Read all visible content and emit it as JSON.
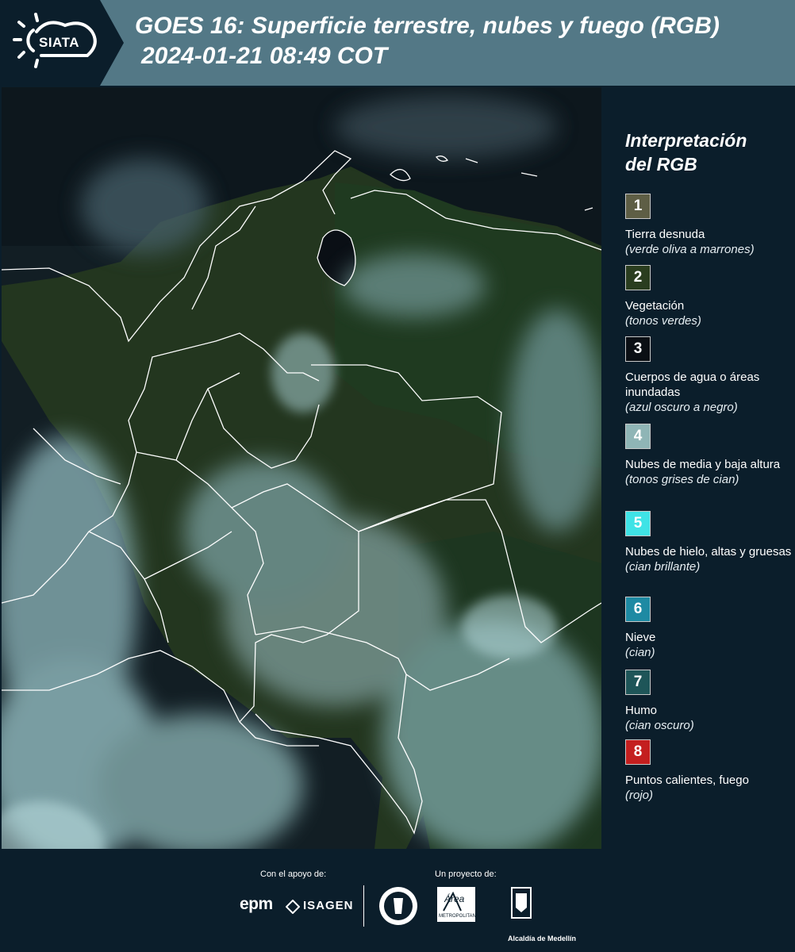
{
  "header": {
    "logo_text": "SIATA",
    "title": "GOES 16: Superficie terrestre, nubes y fuego (RGB)",
    "timestamp": "2024-01-21 08:49 COT"
  },
  "legend": {
    "title_line1": "Interpretación",
    "title_line2": "del RGB",
    "items": [
      {
        "number": "1",
        "label": "Tierra desnuda",
        "desc": "(verde oliva a marrones)",
        "color": "#5e5e45"
      },
      {
        "number": "2",
        "label": "Vegetación",
        "desc": "(tonos verdes)",
        "color": "#2a3d1f"
      },
      {
        "number": "3",
        "label": "Cuerpos de agua o áreas inundadas",
        "desc": "(azul oscuro a negro)",
        "color": "#0b0f14"
      },
      {
        "number": "4",
        "label": "Nubes de media y baja altura",
        "desc": "(tonos grises de cian)",
        "color": "#8fb5b6"
      },
      {
        "number": "5",
        "label": "Nubes de hielo, altas y gruesas",
        "desc": "(cian brillante)",
        "color": "#3fe3e6"
      },
      {
        "number": "6",
        "label": "Nieve",
        "desc": "(cian)",
        "color": "#1e8aa3"
      },
      {
        "number": "7",
        "label": "Humo",
        "desc": "(cian oscuro)",
        "color": "#1e5558"
      },
      {
        "number": "8",
        "label": "Puntos calientes, fuego",
        "desc": "(rojo)",
        "color": "#c41f1f"
      }
    ]
  },
  "footer": {
    "support_label": "Con el apoyo de:",
    "project_label": "Un proyecto de:",
    "epm": "epm",
    "isagen": "ISAGEN",
    "area_metro": "Área",
    "area_metro_sub": "METROPOLITANA",
    "alcaldia": "Alcaldía de Medellín"
  },
  "colors": {
    "header_bg": "#537886",
    "logo_bg": "#0b1e2b",
    "panel_bg": "#0b1e2b"
  }
}
